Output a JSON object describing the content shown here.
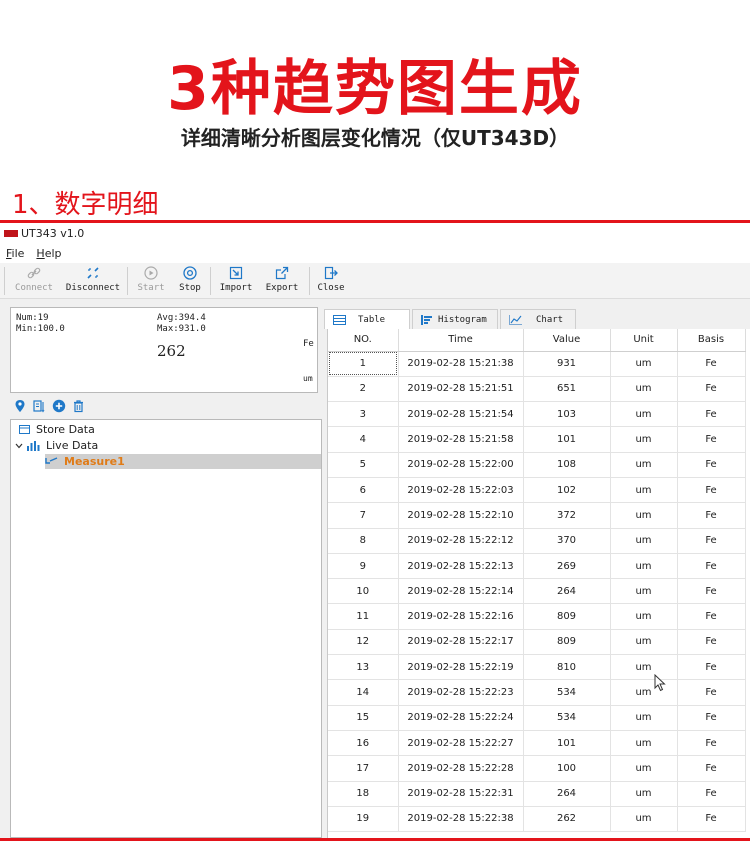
{
  "hero": {
    "title": "3种趋势图生成",
    "subtitle": "详细清晰分析图层变化情况（仅UT343D）",
    "section": "1、数字明细"
  },
  "colors": {
    "brand_red": "#e3141b",
    "selected_orange": "#e07b17",
    "icon_blue": "#1f78c8"
  },
  "app": {
    "title": "UT343 v1.0",
    "menu": [
      "File",
      "Help"
    ],
    "toolbar": {
      "connect": "Connect",
      "disconnect": "Disconnect",
      "start": "Start",
      "stop": "Stop",
      "import": "Import",
      "export": "Export",
      "close": "Close"
    },
    "stats": {
      "num": "Num:19",
      "avg": "Avg:394.4",
      "min": "Min:100.0",
      "max": "Max:931.0",
      "basis": "Fe",
      "current": "262",
      "unit": "um"
    },
    "tree": {
      "store": "Store Data",
      "live": "Live Data",
      "measure": "Measure1"
    },
    "tabs": [
      "Table",
      "Histogram",
      "Chart"
    ],
    "table": {
      "headers": [
        "NO.",
        "Time",
        "Value",
        "Unit",
        "Basis"
      ],
      "rows": [
        [
          "1",
          "2019-02-28 15:21:38",
          "931",
          "um",
          "Fe"
        ],
        [
          "2",
          "2019-02-28 15:21:51",
          "651",
          "um",
          "Fe"
        ],
        [
          "3",
          "2019-02-28 15:21:54",
          "103",
          "um",
          "Fe"
        ],
        [
          "4",
          "2019-02-28 15:21:58",
          "101",
          "um",
          "Fe"
        ],
        [
          "5",
          "2019-02-28 15:22:00",
          "108",
          "um",
          "Fe"
        ],
        [
          "6",
          "2019-02-28 15:22:03",
          "102",
          "um",
          "Fe"
        ],
        [
          "7",
          "2019-02-28 15:22:10",
          "372",
          "um",
          "Fe"
        ],
        [
          "8",
          "2019-02-28 15:22:12",
          "370",
          "um",
          "Fe"
        ],
        [
          "9",
          "2019-02-28 15:22:13",
          "269",
          "um",
          "Fe"
        ],
        [
          "10",
          "2019-02-28 15:22:14",
          "264",
          "um",
          "Fe"
        ],
        [
          "11",
          "2019-02-28 15:22:16",
          "809",
          "um",
          "Fe"
        ],
        [
          "12",
          "2019-02-28 15:22:17",
          "809",
          "um",
          "Fe"
        ],
        [
          "13",
          "2019-02-28 15:22:19",
          "810",
          "um",
          "Fe"
        ],
        [
          "14",
          "2019-02-28 15:22:23",
          "534",
          "um",
          "Fe"
        ],
        [
          "15",
          "2019-02-28 15:22:24",
          "534",
          "um",
          "Fe"
        ],
        [
          "16",
          "2019-02-28 15:22:27",
          "101",
          "um",
          "Fe"
        ],
        [
          "17",
          "2019-02-28 15:22:28",
          "100",
          "um",
          "Fe"
        ],
        [
          "18",
          "2019-02-28 15:22:31",
          "264",
          "um",
          "Fe"
        ],
        [
          "19",
          "2019-02-28 15:22:38",
          "262",
          "um",
          "Fe"
        ]
      ]
    }
  }
}
